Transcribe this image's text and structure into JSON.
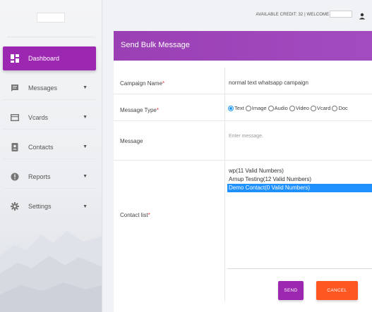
{
  "header": {
    "credit_text": "AVAILABLE CREDIT: 32 | WELCOME,"
  },
  "sidebar": {
    "items": [
      {
        "label": "Dashboard",
        "icon": "dashboard-icon"
      },
      {
        "label": "Messages",
        "icon": "message-icon"
      },
      {
        "label": "Vcards",
        "icon": "vcard-icon"
      },
      {
        "label": "Contacts",
        "icon": "contacts-icon"
      },
      {
        "label": "Reports",
        "icon": "info-icon"
      },
      {
        "label": "Settings",
        "icon": "gear-icon"
      }
    ],
    "active": "Dashboard"
  },
  "form": {
    "title": "Send Bulk Message",
    "campaign_label": "Campaign Name",
    "campaign_value": "normal text whatsapp campaign",
    "type_label": "Message Type",
    "types": [
      "Text",
      "Image",
      "Audio",
      "Video",
      "Vcard",
      "Doc"
    ],
    "selected_type": "Text",
    "message_label": "Message",
    "message_placeholder": "Enter message.",
    "contact_label": "Contact list",
    "contact_options": [
      "wp(11 Valid Numbers)",
      "Arnup Testing(12 Valid Numbers)",
      "Demo Contact(0 Valid Numbers)"
    ],
    "selected_contact": "Demo Contact(0 Valid Numbers)",
    "send_label": "SEND",
    "cancel_label": "CANCEL",
    "required_marker": "*"
  },
  "colors": {
    "primary": "#9c27b0",
    "cancel": "#ff5722",
    "selected": "#1e90ff"
  }
}
